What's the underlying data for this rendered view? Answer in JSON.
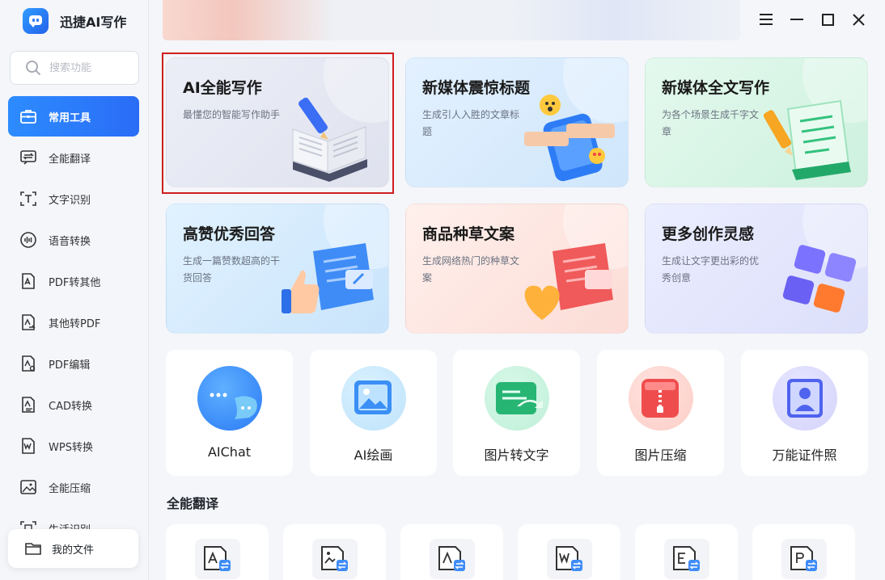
{
  "app": {
    "name": "迅捷AI写作"
  },
  "search": {
    "placeholder": "搜索功能"
  },
  "sidebar": {
    "items": [
      {
        "label": "常用工具",
        "icon": "toolbox-icon",
        "active": true
      },
      {
        "label": "全能翻译",
        "icon": "translate-icon"
      },
      {
        "label": "文字识别",
        "icon": "text-recognition-icon"
      },
      {
        "label": "语音转换",
        "icon": "voice-icon"
      },
      {
        "label": "PDF转其他",
        "icon": "pdf-convert-icon"
      },
      {
        "label": "其他转PDF",
        "icon": "to-pdf-icon"
      },
      {
        "label": "PDF编辑",
        "icon": "pdf-edit-icon"
      },
      {
        "label": "CAD转换",
        "icon": "cad-icon"
      },
      {
        "label": "WPS转换",
        "icon": "wps-icon"
      },
      {
        "label": "全能压缩",
        "icon": "compress-icon"
      },
      {
        "label": "生活识别",
        "icon": "scan-icon"
      }
    ],
    "my_files": "我的文件"
  },
  "window_controls": [
    "menu-icon",
    "minimize-icon",
    "maximize-icon",
    "close-icon"
  ],
  "cards": [
    {
      "title": "AI全能写作",
      "desc": "最懂您的智能写作助手",
      "selected": true
    },
    {
      "title": "新媒体震惊标题",
      "desc": "生成引人入胜的文章标题"
    },
    {
      "title": "新媒体全文写作",
      "desc": "为各个场景生成千字文章"
    },
    {
      "title": "高赞优秀回答",
      "desc": "生成一篇赞数超高的干货回答"
    },
    {
      "title": "商品种草文案",
      "desc": "生成网络热门的种草文案"
    },
    {
      "title": "更多创作灵感",
      "desc": "生成让文字更出彩的优秀创意"
    }
  ],
  "tools": [
    {
      "label": "AIChat",
      "icon": "chat-bubble-icon"
    },
    {
      "label": "AI绘画",
      "icon": "picture-icon"
    },
    {
      "label": "图片转文字",
      "icon": "image-to-text-icon"
    },
    {
      "label": "图片压缩",
      "icon": "zip-icon"
    },
    {
      "label": "万能证件照",
      "icon": "id-photo-icon"
    }
  ],
  "section": {
    "title": "全能翻译"
  },
  "translate_tools": [
    "text-translate-icon",
    "image-translate-icon",
    "pdf-translate-icon",
    "word-translate-icon",
    "excel-translate-icon",
    "ppt-translate-icon"
  ],
  "colors": {
    "accent": "#2a7bfa",
    "selected_border": "#d01e1e"
  }
}
